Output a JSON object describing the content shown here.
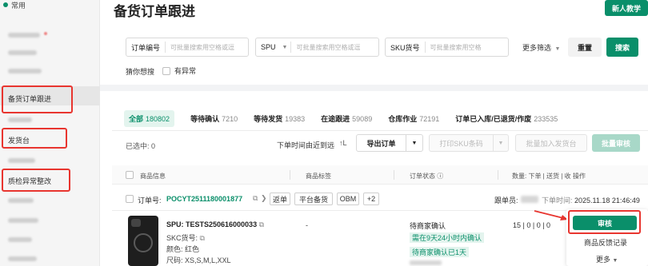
{
  "sidebar": {
    "top_label": "常用",
    "items": [
      {
        "label": "备货订单跟进"
      },
      {
        "label": "发货台"
      },
      {
        "label": "质检异常整改"
      }
    ]
  },
  "header": {
    "title": "备货订单跟进",
    "tutorial_button": "新人教学"
  },
  "filters": {
    "order_no": {
      "label": "订单编号",
      "placeholder": "可批量搜索用空格或逗"
    },
    "spu": {
      "label": "SPU",
      "placeholder": "可批量搜索用空格或逗"
    },
    "sku": {
      "label": "SKU货号",
      "placeholder": "可批量搜索用空格"
    },
    "more": "更多筛选",
    "reset": "重置",
    "search": "搜索",
    "guess": "猜你想搜",
    "abnormal": "有异常"
  },
  "status_tabs": [
    {
      "label": "全部",
      "count": "180802"
    },
    {
      "label": "等待确认",
      "count": "7210"
    },
    {
      "label": "等待发货",
      "count": "19383"
    },
    {
      "label": "在途跟进",
      "count": "59089"
    },
    {
      "label": "仓库作业",
      "count": "72191"
    },
    {
      "label": "订单已入库/已退货/作废",
      "count": "233535"
    }
  ],
  "toolbar": {
    "selected": "已选中: 0",
    "sort_label": "下单时间由近到远",
    "sort_icon": "↑L",
    "export": "导出订单",
    "print_sku": "打印SKU条码",
    "batch_add_shipping": "批量加入发货台",
    "batch_review": "批量审核"
  },
  "table_headers": {
    "product": "商品信息",
    "tags": "商品标签",
    "status": "订单状态 ⓘ",
    "quantity": "数量: 下单 | 送货 | 收",
    "action": "操作"
  },
  "order": {
    "label": "订单号:",
    "number": "POCYT2511180001877",
    "copy_icon": "⧉",
    "more_icon": "❯",
    "tags": [
      "返单",
      "平台备货",
      "OBM",
      "+2"
    ],
    "follower_label": "跟单员:",
    "time_label": "下单时间:",
    "time_value": "2025.11.18 21:46:49",
    "product": {
      "spu": "SPU: TESTS250616000033",
      "skc_label": "SKC货号:",
      "color": "颜色: 红色",
      "size": "尺码: XS,S,M,L,XXL"
    },
    "tag_value": "-",
    "status": "待商家确认",
    "status_tags": [
      "需在9天24小时内确认",
      "待商家确认已1天"
    ],
    "quantity": "15 | 0 | 0 | 0",
    "actions": {
      "review": "审核",
      "feedback": "商品反馈记录",
      "more": "更多"
    }
  },
  "colors": {
    "brand": "#0a8f6a",
    "highlight": "#e8352f"
  }
}
